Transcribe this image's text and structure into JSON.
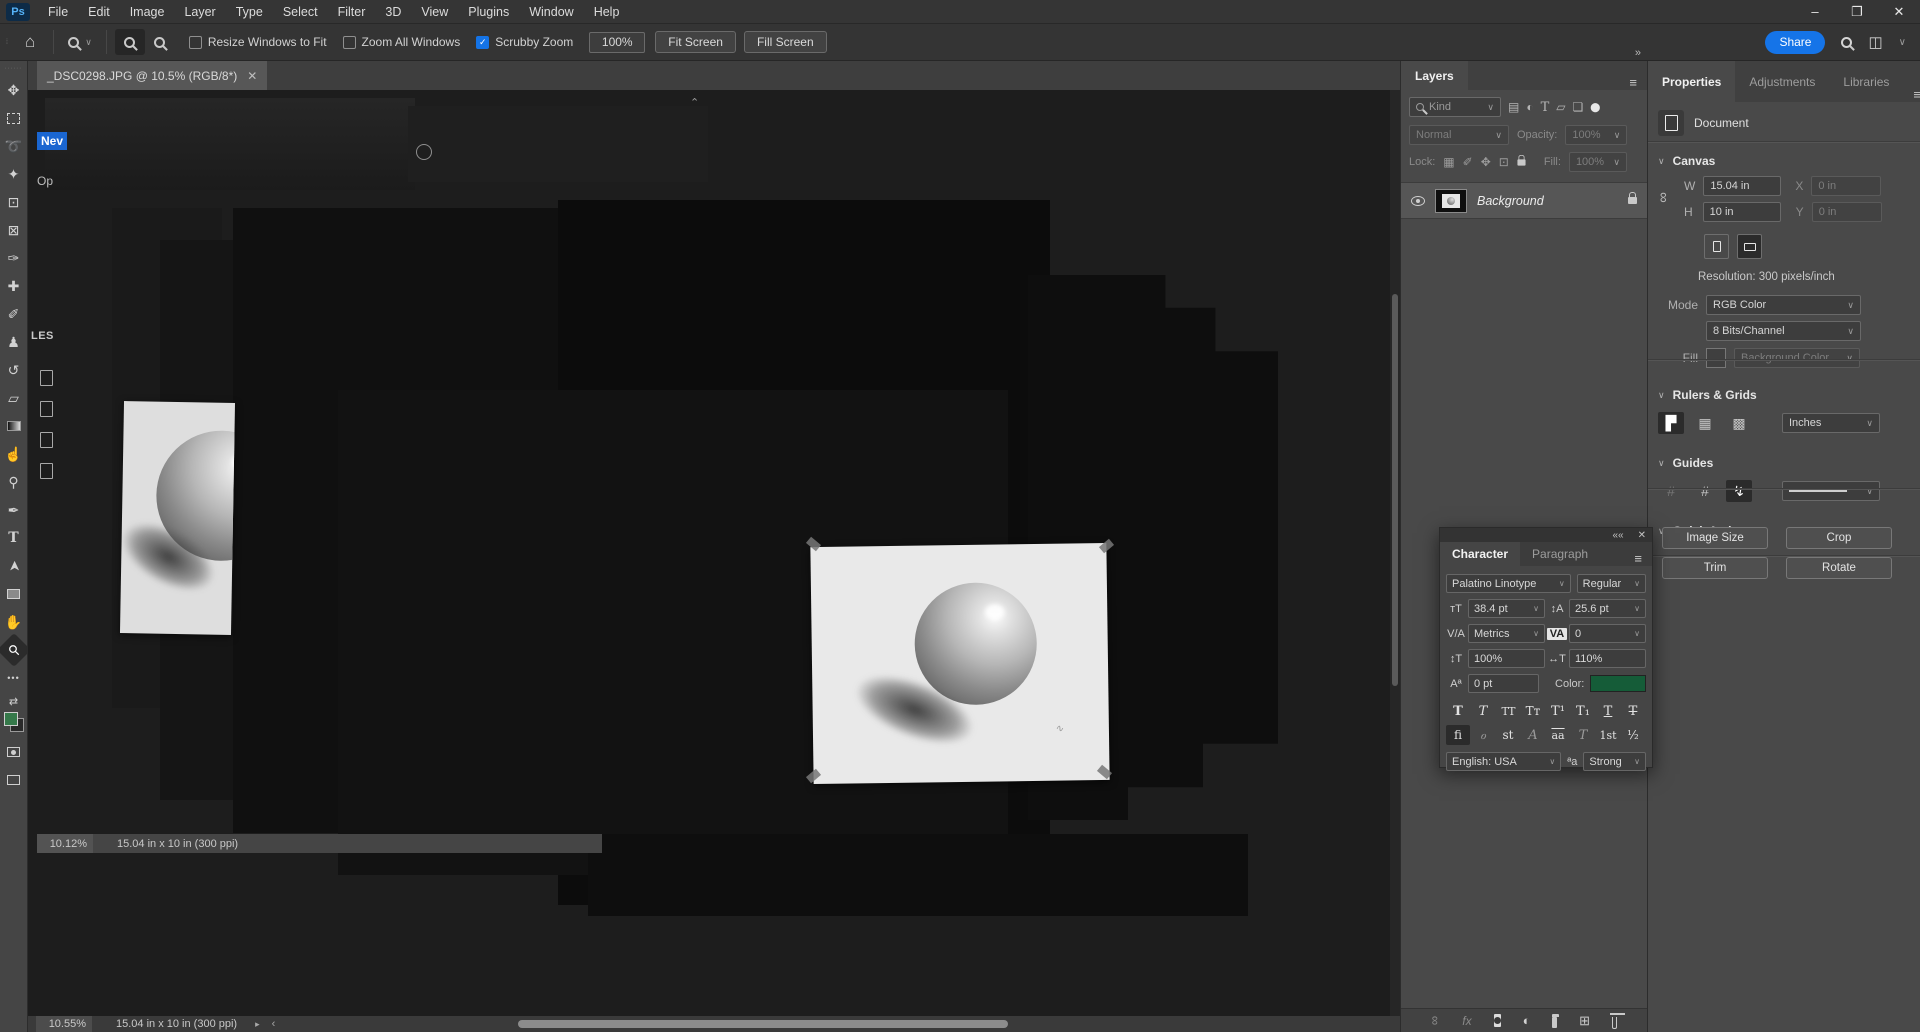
{
  "menu_bar": {
    "logo": "Ps",
    "items": [
      "File",
      "Edit",
      "Image",
      "Layer",
      "Type",
      "Select",
      "Filter",
      "3D",
      "View",
      "Plugins",
      "Window",
      "Help"
    ]
  },
  "window_controls": {
    "minimize": "–",
    "restore": "❐",
    "close": "✕"
  },
  "options_bar": {
    "home_icon": "⌂",
    "tool_chevron": "∨",
    "check_glyph": "✓",
    "zoom_in_plus": "+",
    "zoom_out_minus": "–",
    "checkboxes": [
      {
        "label": "Resize Windows to Fit",
        "checked": false
      },
      {
        "label": "Zoom All Windows",
        "checked": false
      },
      {
        "label": "Scrubby Zoom",
        "checked": true
      }
    ],
    "zoom_value": "100%",
    "fit_screen": "Fit Screen",
    "fill_screen": "Fill Screen",
    "share": "Share",
    "workspace_icon": "◫",
    "chevron": "∨"
  },
  "document_tab": {
    "title": "_DSC0298.JPG @ 10.5% (RGB/8*)",
    "close": "✕"
  },
  "toolbar": {
    "grip": "∙∙∙∙∙∙",
    "tools": [
      {
        "name": "move-tool",
        "glyph": "✥"
      },
      {
        "name": "marquee-tool",
        "glyph": ""
      },
      {
        "name": "lasso-tool",
        "glyph": "➰"
      },
      {
        "name": "object-selection-tool",
        "glyph": "✦"
      },
      {
        "name": "crop-tool",
        "glyph": "⊡"
      },
      {
        "name": "frame-tool",
        "glyph": "⊠"
      },
      {
        "name": "eyedropper-tool",
        "glyph": "✑"
      },
      {
        "name": "healing-brush-tool",
        "glyph": "✚"
      },
      {
        "name": "brush-tool",
        "glyph": "✐"
      },
      {
        "name": "clone-stamp-tool",
        "glyph": "♟"
      },
      {
        "name": "history-brush-tool",
        "glyph": "↺"
      },
      {
        "name": "eraser-tool",
        "glyph": "▱"
      },
      {
        "name": "gradient-tool",
        "glyph": ""
      },
      {
        "name": "smudge-tool",
        "glyph": "☝"
      },
      {
        "name": "dodge-tool",
        "glyph": "⚲"
      },
      {
        "name": "pen-tool",
        "glyph": "✒"
      },
      {
        "name": "type-tool",
        "glyph": "T"
      },
      {
        "name": "path-selection-tool",
        "glyph": "➤"
      },
      {
        "name": "rectangle-tool",
        "glyph": ""
      },
      {
        "name": "hand-tool",
        "glyph": "✋"
      },
      {
        "name": "zoom-tool",
        "glyph": "⚲"
      },
      {
        "name": "edit-toolbar",
        "glyph": "•••"
      }
    ],
    "swap_icon": "⇄"
  },
  "canvas": {
    "overlay_new": "Nev",
    "overlay_open": "Op",
    "overlay_files": "LES",
    "scroll_arrow": "⌃",
    "signature": "∿",
    "floating_status": {
      "zoom": "10.12%",
      "info": "15.04 in x 10 in (300 ppi)"
    }
  },
  "status_bar": {
    "zoom": "10.55%",
    "info": "15.04 in x 10 in (300 ppi)",
    "next": "▸",
    "prev": "‹"
  },
  "layers_panel": {
    "collapse_icon": "»",
    "title": "Layers",
    "menu_icon": "≡",
    "filter_label": "Kind",
    "filter_chevron": "∨",
    "filter_icons": {
      "pixel": "▤",
      "adjustment": "◐",
      "type": "T",
      "shape": "▱",
      "smart": "❏",
      "toggle": "⬤"
    },
    "blend_mode": "Normal",
    "opacity_label": "Opacity:",
    "opacity_value": "100%",
    "lock_label": "Lock:",
    "lock_icons": {
      "transparent": "▦",
      "pixels": "✐",
      "position": "✥",
      "artboard": "⊡"
    },
    "fill_label": "Fill:",
    "fill_value": "100%",
    "layer_name": "Background",
    "bottom_icons": {
      "link": "∞",
      "fx": "fx",
      "adjustment": "◐",
      "new": "⊞"
    }
  },
  "properties_panel": {
    "tabs": [
      "Properties",
      "Adjustments",
      "Libraries"
    ],
    "menu_icon": "≡",
    "document_label": "Document",
    "canvas_section": {
      "chevron": "∨",
      "title": "Canvas",
      "link_icon": "∞",
      "w_label": "W",
      "w_value": "15.04 in",
      "x_label": "X",
      "x_value": "0 in",
      "h_label": "H",
      "h_value": "10 in",
      "y_label": "Y",
      "y_value": "0 in",
      "resolution": "Resolution: 300 pixels/inch",
      "mode_label": "Mode",
      "mode_value": "RGB Color",
      "depth_value": "8 Bits/Channel",
      "fill_label": "Fill",
      "fill_value": "Background Color"
    },
    "rulers_section": {
      "chevron": "∨",
      "title": "Rulers & Grids",
      "ruler_icon": "▛",
      "grid_icon": "▦",
      "checker_icon": "▩",
      "units": "Inches"
    },
    "guides_section": {
      "chevron": "∨",
      "title": "Guides",
      "guides_icon": "#",
      "lock_icon": "#",
      "snap_icon": "↯"
    },
    "quick_actions": {
      "chevron": "∨",
      "title": "Quick Actions",
      "buttons": [
        "Image Size",
        "Crop",
        "Trim",
        "Rotate"
      ]
    }
  },
  "character_panel": {
    "collapse_icon": "««",
    "close_icon": "✕",
    "menu_icon": "≡",
    "tabs": [
      "Character",
      "Paragraph"
    ],
    "font_family": "Palatino Linotype",
    "font_style": "Regular",
    "size_icon": "тT",
    "size_value": "38.4 pt",
    "leading_icon": "↕A",
    "leading_value": "25.6 pt",
    "kerning_icon": "V/A",
    "kerning_value": "Metrics",
    "tracking_icon": "VA",
    "tracking_value": "0",
    "vscale_icon": "↕T",
    "vscale_value": "100%",
    "hscale_icon": "↔T",
    "hscale_value": "110%",
    "baseline_icon": "Aª",
    "baseline_value": "0 pt",
    "color_label": "Color:",
    "styles": [
      "T",
      "T",
      "TT",
      "Tᴛ",
      "T¹",
      "T₁",
      "T",
      "T"
    ],
    "alts": [
      "fi",
      "ℴ",
      "st",
      "A",
      "aa",
      "T",
      "1st",
      "½"
    ],
    "language": "English: USA",
    "antialias_icon": "ªa",
    "antialias": "Strong",
    "dd": "∨"
  },
  "colors": {
    "accent_blue": "#1473e6",
    "share_blue": "#1574e8",
    "foreground_swatch_green": "#35794a",
    "character_color_green": "#155c38"
  }
}
